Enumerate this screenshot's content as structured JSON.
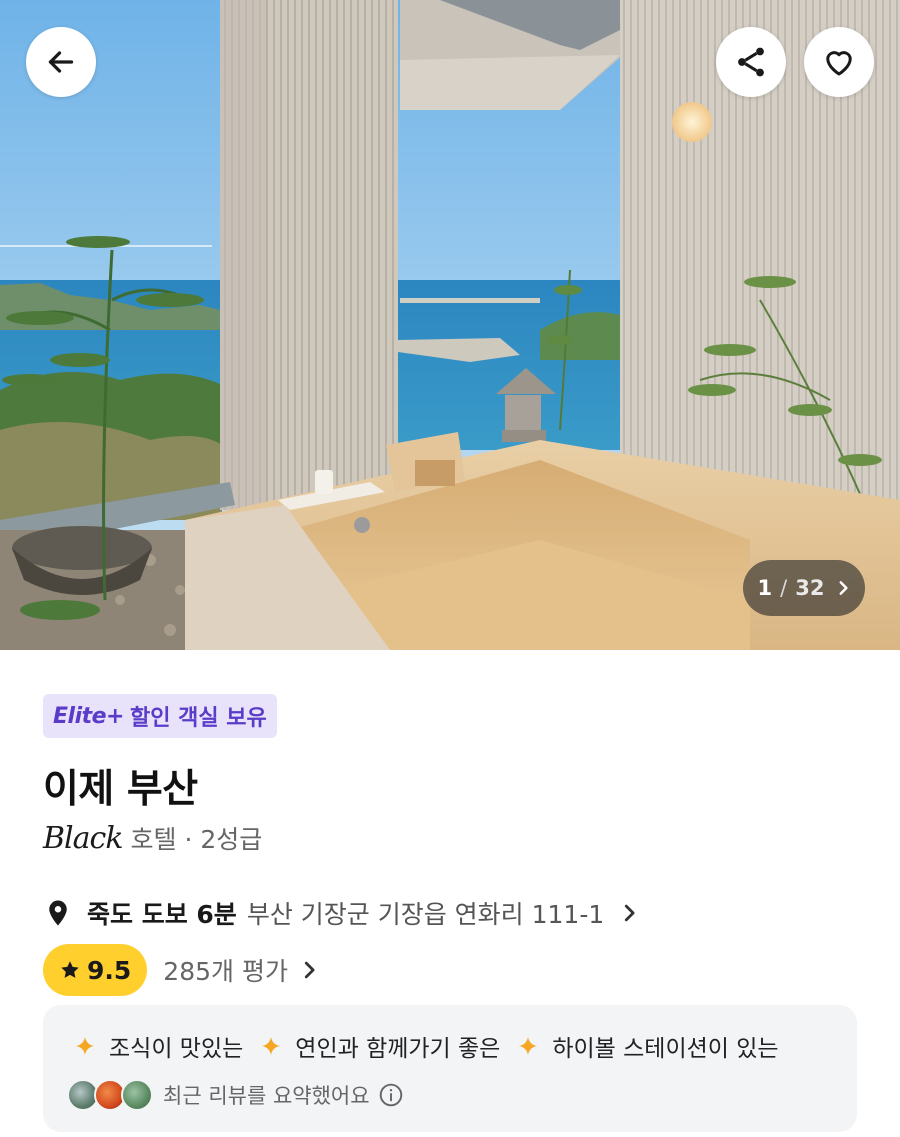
{
  "hero": {
    "counter_current": "1",
    "counter_separator": "/",
    "counter_total": "32"
  },
  "header": {
    "back_icon": "arrow-left-icon",
    "share_icon": "share-icon",
    "like_icon": "heart-outline-icon"
  },
  "badge": {
    "elite": "Elite+",
    "text": "할인 객실 보유"
  },
  "hotel": {
    "name": "이제 부산",
    "brand_logo_text": "Black",
    "grade": "호텔 · 2성급"
  },
  "location": {
    "icon": "map-pin-icon",
    "walk": "죽도 도보 6분",
    "address": "부산 기장군 기장읍 연화리 111-1"
  },
  "rating": {
    "score": "9.5",
    "reviews": "285개 평가"
  },
  "summary": {
    "tags": [
      "조식이 맛있는",
      "연인과 함께가기 좋은",
      "하이볼 스테이션이 있는"
    ],
    "note": "최근 리뷰를 요약했어요"
  },
  "colors": {
    "badge_bg": "#e8e2fb",
    "badge_text": "#5b3cc9",
    "rating_bg": "#ffcf2e",
    "sparkle": "#f5a623",
    "card_bg": "#f3f4f6"
  }
}
